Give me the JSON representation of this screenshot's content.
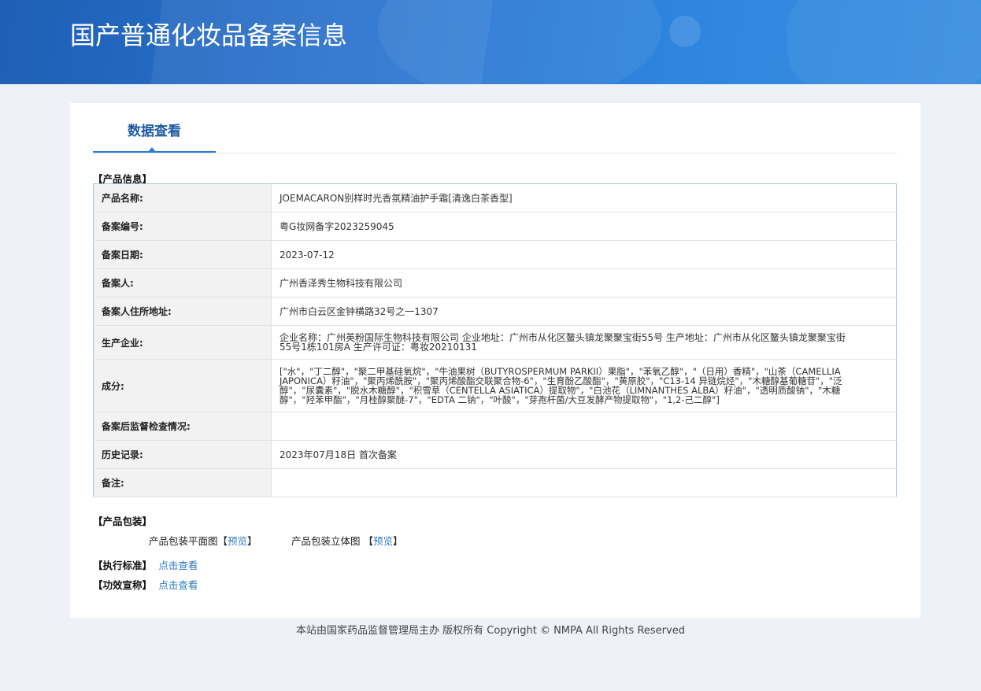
{
  "header": {
    "title": "国产普通化妆品备案信息"
  },
  "tab": {
    "label": "数据查看"
  },
  "sections": {
    "product_info": "【产品信息】",
    "packaging": "【产品包装】",
    "standard": "【执行标准】",
    "efficacy": "【功效宣称】"
  },
  "product": [
    {
      "key": "产品名称:",
      "value": "JOEMACARON别样时光香氛精油护手霜[清逸白茶香型]"
    },
    {
      "key": "备案编号:",
      "value": "粤G妆网备字2023259045"
    },
    {
      "key": "备案日期:",
      "value": "2023-07-12"
    },
    {
      "key": "备案人:",
      "value": "广州香泽秀生物科技有限公司"
    },
    {
      "key": "备案人住所地址:",
      "value": "广州市白云区金钟横路32号之一1307"
    },
    {
      "key": "生产企业:",
      "value": "企业名称：广州英粉国际生物科技有限公司 企业地址：广州市从化区鳌头镇龙聚聚宝街55号 生产地址：广州市从化区鳌头镇龙聚聚宝街55号1栋101房A 生产许可证：粤妆20210131"
    },
    {
      "key": "成分:",
      "value": "[\"水\"，\"丁二醇\"，\"聚二甲基硅氧烷\"，\"牛油果树（BUTYROSPERMUM PARKII）果脂\"，\"苯氧乙醇\"，\"（日用）香精\"，\"山茶（CAMELLIA JAPONICA）籽油\"，\"聚丙烯酰胺\"，\"聚丙烯酸酯交联聚合物-6\"，\"生育酚乙酸酯\"，\"黄原胶\"，\"C13-14 异链烷烃\"，\"木糖醇基葡糖苷\"，\"泛醇\"，\"尿囊素\"，\"脱水木糖醇\"，\"积雪草（CENTELLA ASIATICA）提取物\"，\"白池花（LIMNANTHES ALBA）籽油\"，\"透明质酸钠\"，\"木糖醇\"，\"羟苯甲酯\"，\"月桂醇聚醚-7\"，\"EDTA 二钠\"，\"叶酸\"，\"芽孢杆菌/大豆发酵产物提取物\"，\"1,2-己二醇\"]"
    },
    {
      "key": "备案后监督检查情况:",
      "value": ""
    },
    {
      "key": "历史记录:",
      "value": "2023年07月18日 首次备案"
    },
    {
      "key": "备注:",
      "value": ""
    }
  ],
  "packaging": {
    "flat_label": "产品包装平面图",
    "solid_label": "产品包装立体图",
    "bracket_open": "【",
    "bracket_close": "】",
    "preview": "预览"
  },
  "links": {
    "view": "点击查看"
  },
  "footer": {
    "text": "本站由国家药品监督管理局主办 版权所有 Copyright © NMPA All Rights Reserved"
  },
  "colors": {
    "banner": "#2a74d0",
    "link": "#2e7bc4",
    "tab_text": "#1e5aa5",
    "page_bg": "#eef2f6"
  }
}
